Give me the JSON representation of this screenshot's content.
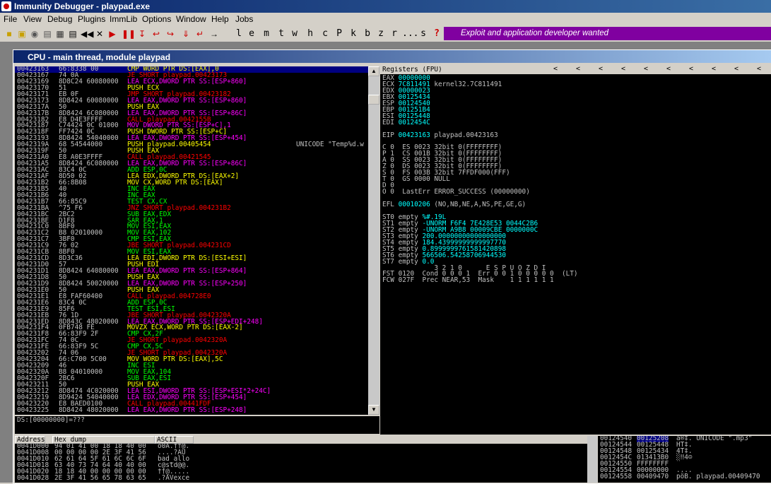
{
  "window": {
    "title": "Immunity Debugger - playpad.exe"
  },
  "menu": [
    "File",
    "View",
    "Debug",
    "Plugins",
    "ImmLib",
    "Options",
    "Window",
    "Help",
    "Jobs"
  ],
  "toolbar_letters": [
    "l",
    "e",
    "m",
    "t",
    "w",
    "h",
    "c",
    "P",
    "k",
    "b",
    "z",
    "r",
    "...",
    "s",
    "?"
  ],
  "banner": "Exploit and application developer wanted",
  "cpu_title": "CPU - main thread, module playpad",
  "colors": {
    "title": "#0a246a",
    "banner": "#8000a0",
    "yellow": "#ffff00",
    "magenta": "#ff00ff",
    "red": "#ff0000",
    "green": "#00ff00",
    "cyan": "#00ffff",
    "white": "#c0c0c0"
  },
  "disasm": [
    {
      "a": "00423163",
      "h": "66:8338 00",
      "i": "CMP WORD PTR DS:[EAX],0",
      "c": "yellow",
      "sel": true
    },
    {
      "a": "00423167",
      "h": "74 0A",
      "i": "JE SHORT playpad.00423173",
      "c": "red"
    },
    {
      "a": "00423169",
      "h": "8D8C24 60080000",
      "i": "LEA ECX,DWORD PTR SS:[ESP+860]",
      "c": "magenta"
    },
    {
      "a": "00423170",
      "h": "51",
      "i": "PUSH ECX",
      "c": "yellow"
    },
    {
      "a": "00423171",
      "h": "EB 0F",
      "i": "JMP SHORT playpad.00423182",
      "c": "red"
    },
    {
      "a": "00423173",
      "h": "8D8424 60080000",
      "i": "LEA EAX,DWORD PTR SS:[ESP+860]",
      "c": "magenta"
    },
    {
      "a": "0042317A",
      "h": "50",
      "i": "PUSH EAX",
      "c": "yellow"
    },
    {
      "a": "0042317B",
      "h": "8D8424 6C080000",
      "i": "LEA EAX,DWORD PTR SS:[ESP+86C]",
      "c": "magenta"
    },
    {
      "a": "00423182",
      "h": "E8 D4E3FFFF",
      "i": "CALL playpad.0042155B",
      "c": "red"
    },
    {
      "a": "00423187",
      "h": "C74424 0C 01000",
      "i": "MOV DWORD PTR SS:[ESP+C],1",
      "c": "magenta"
    },
    {
      "a": "0042318F",
      "h": "FF7424 0C",
      "i": "PUSH DWORD PTR SS:[ESP+C]",
      "c": "yellow"
    },
    {
      "a": "00423193",
      "h": "8D8424 54040000",
      "i": "LEA EAX,DWORD PTR SS:[ESP+454]",
      "c": "magenta"
    },
    {
      "a": "0042319A",
      "h": "68 54544000",
      "i": "PUSH playpad.00405454",
      "c": "yellow",
      "m": "UNICODE \"Temp%d.w"
    },
    {
      "a": "0042319F",
      "h": "50",
      "i": "PUSH EAX",
      "c": "yellow"
    },
    {
      "a": "004231A0",
      "h": "E8 A0E3FFFF",
      "i": "CALL playpad.00421545",
      "c": "red"
    },
    {
      "a": "004231A5",
      "h": "8D8424 6C080000",
      "i": "LEA EAX,DWORD PTR SS:[ESP+86C]",
      "c": "magenta"
    },
    {
      "a": "004231AC",
      "h": "83C4 0C",
      "i": "ADD ESP,0C",
      "c": "green"
    },
    {
      "a": "004231AF",
      "h": "8D50 02",
      "i": "LEA EDX,DWORD PTR DS:[EAX+2]",
      "c": "yellow"
    },
    {
      "a": "004231B2",
      "h": "66:8B08",
      "i": "MOV CX,WORD PTR DS:[EAX]",
      "c": "yellow"
    },
    {
      "a": "004231B5",
      "h": "40",
      "i": "INC EAX",
      "c": "green"
    },
    {
      "a": "004231B6",
      "h": "40",
      "i": "INC EAX",
      "c": "green"
    },
    {
      "a": "004231B7",
      "h": "66:85C9",
      "i": "TEST CX,CX",
      "c": "green"
    },
    {
      "a": "004231BA",
      "h": "^75 F6",
      "i": "JNZ SHORT playpad.004231B2",
      "c": "red"
    },
    {
      "a": "004231BC",
      "h": "2BC2",
      "i": "SUB EAX,EDX",
      "c": "green"
    },
    {
      "a": "004231BE",
      "h": "D1F8",
      "i": "SAR EAX,1",
      "c": "green"
    },
    {
      "a": "004231C0",
      "h": "8BF0",
      "i": "MOV ESI,EAX",
      "c": "green"
    },
    {
      "a": "004231C2",
      "h": "B8 02010000",
      "i": "MOV EAX,102",
      "c": "green"
    },
    {
      "a": "004231C7",
      "h": "3BF0",
      "i": "CMP ESI,EAX",
      "c": "green"
    },
    {
      "a": "004231C9",
      "h": "76 02",
      "i": "JBE SHORT playpad.004231CD",
      "c": "red"
    },
    {
      "a": "004231CB",
      "h": "8BF0",
      "i": "MOV ESI,EAX",
      "c": "green"
    },
    {
      "a": "004231CD",
      "h": "8D3C36",
      "i": "LEA EDI,DWORD PTR DS:[ESI+ESI]",
      "c": "yellow"
    },
    {
      "a": "004231D0",
      "h": "57",
      "i": "PUSH EDI",
      "c": "yellow"
    },
    {
      "a": "004231D1",
      "h": "8D8424 64080000",
      "i": "LEA EAX,DWORD PTR SS:[ESP+864]",
      "c": "magenta"
    },
    {
      "a": "004231D8",
      "h": "50",
      "i": "PUSH EAX",
      "c": "yellow"
    },
    {
      "a": "004231D9",
      "h": "8D8424 50020000",
      "i": "LEA EAX,DWORD PTR SS:[ESP+250]",
      "c": "magenta"
    },
    {
      "a": "004231E0",
      "h": "50",
      "i": "PUSH EAX",
      "c": "yellow"
    },
    {
      "a": "004231E1",
      "h": "E8 FAF60400",
      "i": "CALL playpad.004728E0",
      "c": "red"
    },
    {
      "a": "004231E6",
      "h": "83C4 0C",
      "i": "ADD ESP,0C",
      "c": "green"
    },
    {
      "a": "004231E9",
      "h": "85F6",
      "i": "TEST ESI,ESI",
      "c": "green"
    },
    {
      "a": "004231EB",
      "h": "76 1D",
      "i": "JBE SHORT playpad.0042320A",
      "c": "red"
    },
    {
      "a": "004231ED",
      "h": "8D843C 48020000",
      "i": "LEA EAX,DWORD PTR SS:[ESP+EDI+248]",
      "c": "magenta"
    },
    {
      "a": "004231F4",
      "h": "0FB748 FE",
      "i": "MOVZX ECX,WORD PTR DS:[EAX-2]",
      "c": "yellow"
    },
    {
      "a": "004231F8",
      "h": "66:83F9 2F",
      "i": "CMP CX,2F",
      "c": "green"
    },
    {
      "a": "004231FC",
      "h": "74 0C",
      "i": "JE SHORT playpad.0042320A",
      "c": "red"
    },
    {
      "a": "004231FE",
      "h": "66:83F9 5C",
      "i": "CMP CX,5C",
      "c": "green"
    },
    {
      "a": "00423202",
      "h": "74 06",
      "i": "JE SHORT playpad.0042320A",
      "c": "red"
    },
    {
      "a": "00423204",
      "h": "66:C700 5C00",
      "i": "MOV WORD PTR DS:[EAX],5C",
      "c": "yellow"
    },
    {
      "a": "00423209",
      "h": "46",
      "i": "INC ESI",
      "c": "green"
    },
    {
      "a": "0042320A",
      "h": "B8 04010000",
      "i": "MOV EAX,104",
      "c": "green"
    },
    {
      "a": "0042320F",
      "h": "2BC6",
      "i": "SUB EAX,ESI",
      "c": "green"
    },
    {
      "a": "00423211",
      "h": "50",
      "i": "PUSH EAX",
      "c": "yellow"
    },
    {
      "a": "00423212",
      "h": "8D8474 4C020000",
      "i": "LEA ESI,DWORD PTR SS:[ESP+ESI*2+24C]",
      "c": "magenta"
    },
    {
      "a": "00423219",
      "h": "8D9424 54040000",
      "i": "LEA EDX,DWORD PTR SS:[ESP+454]",
      "c": "magenta"
    },
    {
      "a": "00423220",
      "h": "E8 BAED0100",
      "i": "CALL playpad.00441FDF",
      "c": "red"
    },
    {
      "a": "00423225",
      "h": "8D8424 48020000",
      "i": "LEA EAX,DWORD PTR SS:[ESP+248]",
      "c": "magenta"
    }
  ],
  "info_line": "DS:[00000000]=???",
  "registers_title": "Registers (FPU)",
  "registers": [
    {
      "t": "EAX 00000000"
    },
    {
      "t": "ECX 7C811491 kernel32.7C811491"
    },
    {
      "t": "EDX 00000023"
    },
    {
      "t": "EBX 00125434"
    },
    {
      "t": "ESP 00124540"
    },
    {
      "t": "EBP 001251B4"
    },
    {
      "t": "ESI 00125448"
    },
    {
      "t": "EDI 0012454C"
    },
    {
      "t": ""
    },
    {
      "t": "EIP 00423163 playpad.00423163"
    },
    {
      "t": ""
    },
    {
      "t": "C 0  ES 0023 32bit 0(FFFFFFFF)"
    },
    {
      "t": "P 1  CS 001B 32bit 0(FFFFFFFF)"
    },
    {
      "t": "A 0  SS 0023 32bit 0(FFFFFFFF)"
    },
    {
      "t": "Z 0  DS 0023 32bit 0(FFFFFFFF)"
    },
    {
      "t": "S 0  FS 003B 32bit 7FFDF000(FFF)"
    },
    {
      "t": "T 0  GS 0000 NULL"
    },
    {
      "t": "D 0"
    },
    {
      "t": "O 0  LastErr ERROR_SUCCESS (00000000)"
    },
    {
      "t": ""
    },
    {
      "t": "EFL 00010206 (NO,NB,NE,A,NS,PE,GE,G)"
    },
    {
      "t": ""
    },
    {
      "t": "ST0 empty %#.19L"
    },
    {
      "t": "ST1 empty -UNORM F6F4 7E428E53 0044C2B6"
    },
    {
      "t": "ST2 empty -UNORM A9B8 00009CBE 0000000C"
    },
    {
      "t": "ST3 empty 200.00000000000000000"
    },
    {
      "t": "ST4 empty 184.43999999999997770"
    },
    {
      "t": "ST5 empty 0.8999999761581420898"
    },
    {
      "t": "ST6 empty 566506.54258706944530"
    },
    {
      "t": "ST7 empty 0.0"
    },
    {
      "t": "             3 2 1 0      E S P U O Z D I"
    },
    {
      "t": "FST 0120  Cond 0 0 0 1  Err 0 0 1 0 0 0 0 0  (LT)"
    },
    {
      "t": "FCW 027F  Prec NEAR,53  Mask    1 1 1 1 1 1"
    }
  ],
  "dump_headers": [
    "Address",
    "Hex dump",
    "ASCII"
  ],
  "dump": [
    {
      "a": "0041D000",
      "h": "94 01 41 00 18 18 40 00",
      "s": "ö0A.††@."
    },
    {
      "a": "0041D008",
      "h": "00 00 00 00 2E 3F 41 56",
      "s": "....?AU"
    },
    {
      "a": "0041D010",
      "h": "62 61 64 5F 61 6C 6C 6F",
      "s": "bad_allo"
    },
    {
      "a": "0041D018",
      "h": "63 40 73 74 64 40 40 00",
      "s": "c@std@@."
    },
    {
      "a": "0041D020",
      "h": "18 18 40 00 00 00 00 00",
      "s": "††@....."
    },
    {
      "a": "0041D028",
      "h": "2E 3F 41 56 65 78 63 65",
      "s": ".?AVexce"
    }
  ],
  "stack": [
    {
      "a": "00124540",
      "v": "00125208",
      "c": "ä®‡. UNICODE \".mp3\"",
      "sel": true
    },
    {
      "a": "00124544",
      "v": "00125448",
      "c": "HT‡."
    },
    {
      "a": "00124548",
      "v": "00125434",
      "c": "4T‡."
    },
    {
      "a": "0012454C",
      "v": "013413B0",
      "c": "░‼4☺"
    },
    {
      "a": "00124550",
      "v": "FFFFFFFF",
      "c": ""
    },
    {
      "a": "00124554",
      "v": "00000000",
      "c": "...."
    },
    {
      "a": "00124558",
      "v": "00409470",
      "c": "pöB. playpad.00409470"
    }
  ]
}
